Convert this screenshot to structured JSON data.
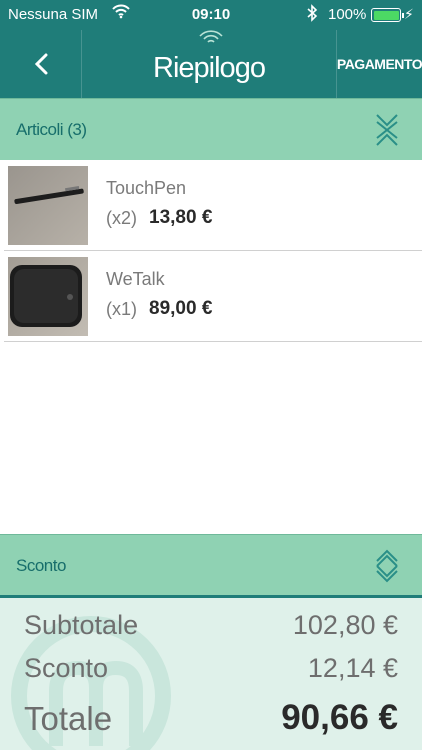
{
  "status_bar": {
    "carrier": "Nessuna SIM",
    "time": "09:10",
    "battery_percent": "100%",
    "battery_color": "#4cd964"
  },
  "navbar": {
    "title": "Riepilogo",
    "pay_label": "PAGAMENTO",
    "back_icon": "chevron-left-icon",
    "color": "#1f7d79"
  },
  "articles_section": {
    "label": "Articoli (3)",
    "toggle_icon": "collapse-icon",
    "color": "#8fd2b3"
  },
  "items": [
    {
      "name": "TouchPen",
      "qty": "(x2)",
      "price": "13,80 €"
    },
    {
      "name": "WeTalk",
      "qty": "(x1)",
      "price": "89,00 €"
    }
  ],
  "discount_section": {
    "label": "Sconto",
    "toggle_icon": "expand-icon"
  },
  "totals": {
    "subtotal_label": "Subtotale",
    "subtotal_value": "102,80 €",
    "discount_label": "Sconto",
    "discount_value": "12,14 €",
    "total_label": "Totale",
    "total_value": "90,66 €"
  }
}
